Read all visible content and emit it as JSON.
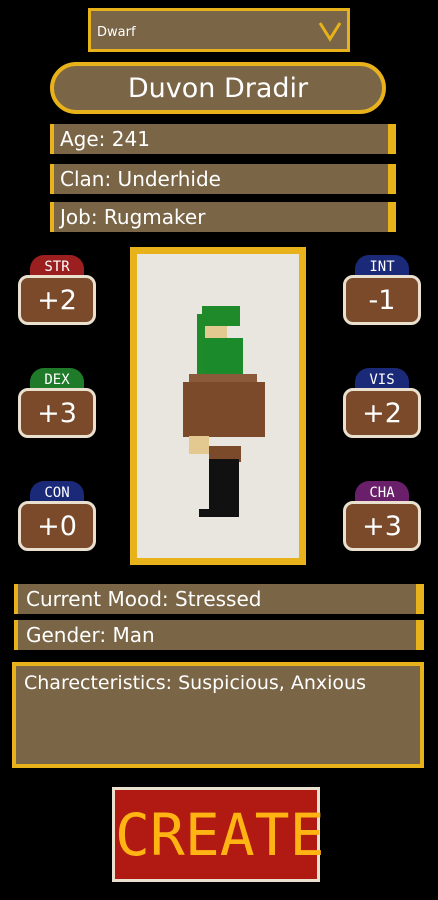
{
  "race_select": {
    "value": "Dwarf"
  },
  "character": {
    "name": "Duvon Dradir",
    "age": "Age: 241",
    "clan": "Clan: Underhide",
    "job": "Job: Rugmaker"
  },
  "stats": {
    "str": {
      "label": "STR",
      "value": "+2"
    },
    "dex": {
      "label": "DEX",
      "value": "+3"
    },
    "con": {
      "label": "CON",
      "value": "+0"
    },
    "int": {
      "label": "INT",
      "value": "-1"
    },
    "vis": {
      "label": "VIS",
      "value": "+2"
    },
    "cha": {
      "label": "CHA",
      "value": "+3"
    }
  },
  "details": {
    "mood": "Current Mood: Stressed",
    "gender": "Gender: Man",
    "characteristics": "Charecteristics: Suspicious, Anxious"
  },
  "actions": {
    "create_label": "CREATE"
  },
  "colors": {
    "panel": "#7a6546",
    "edge": "#e8b21a",
    "button": "#b01a12"
  }
}
